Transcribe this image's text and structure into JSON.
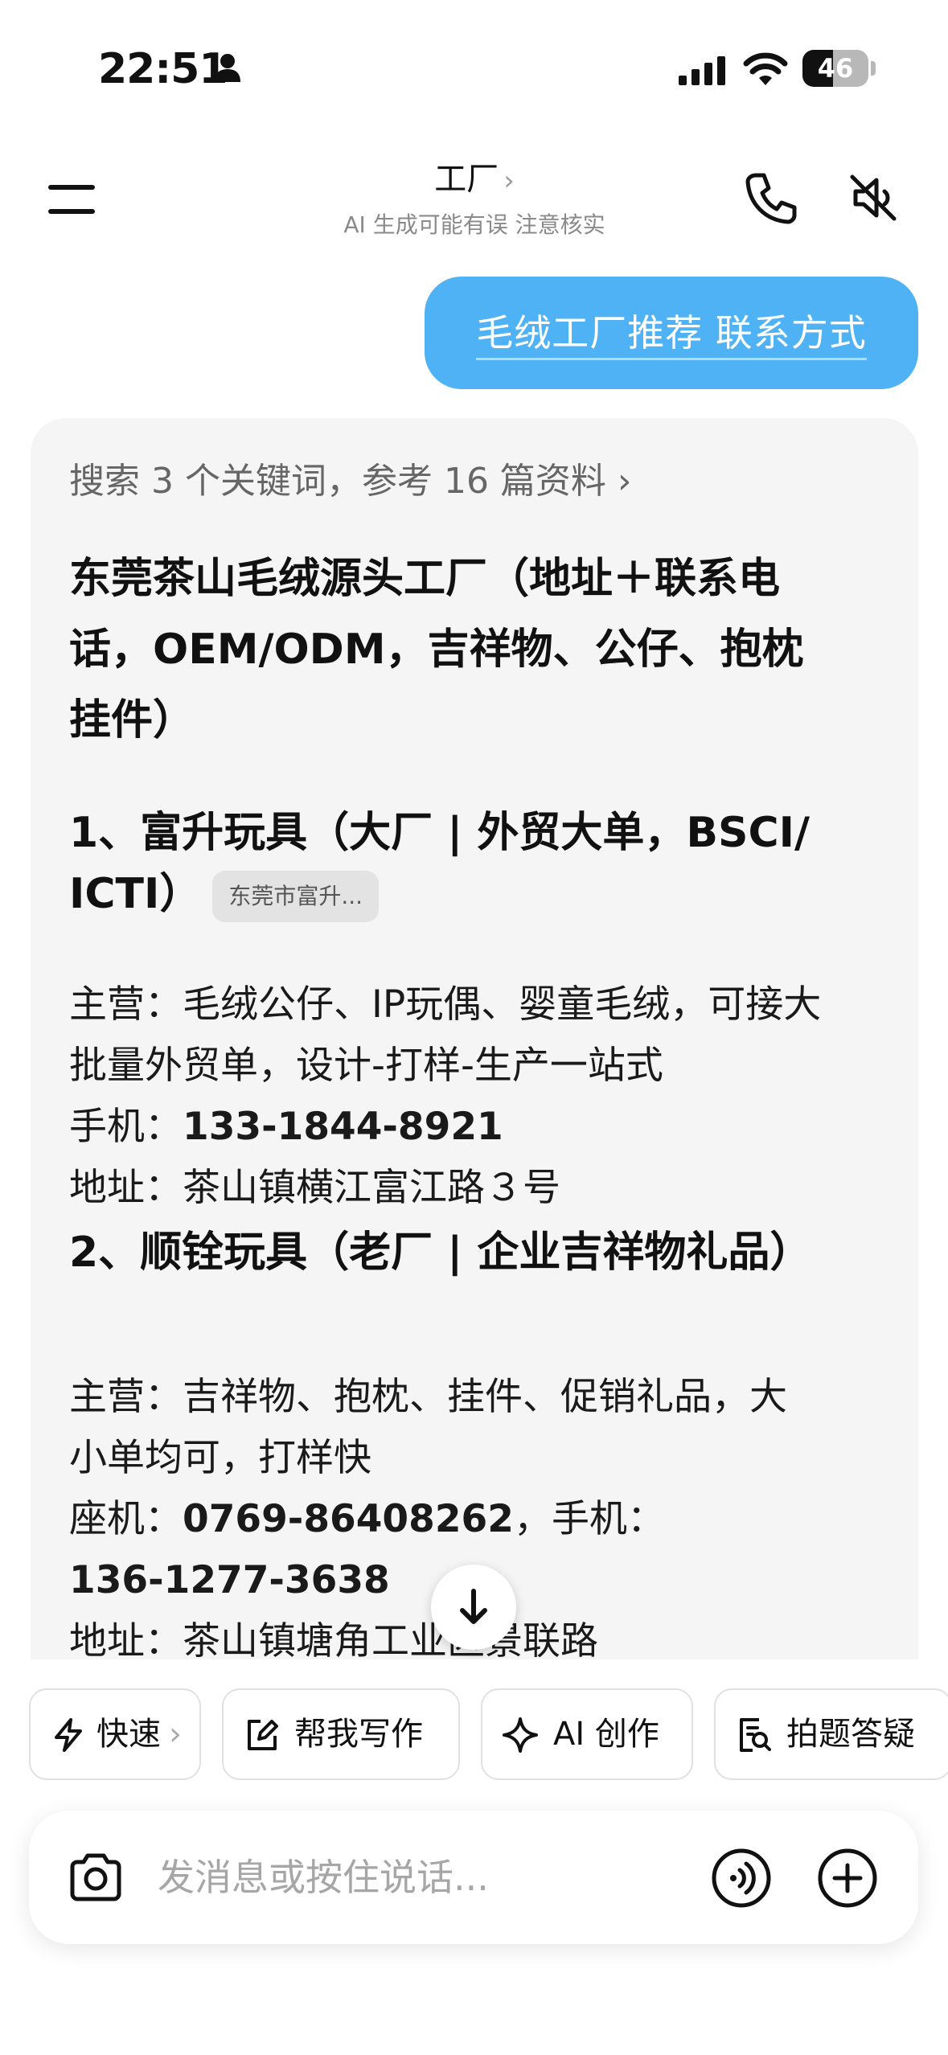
{
  "status_bar": {
    "time": "22:51",
    "battery_level": "46",
    "icons": [
      "person-icon",
      "signal-icon",
      "wifi-icon",
      "battery-icon"
    ]
  },
  "header": {
    "title": "工厂",
    "title_chevron": "›",
    "subtitle": "AI 生成可能有误 注意核实",
    "icons": [
      "menu-icon",
      "phone-icon",
      "speaker-mute-icon"
    ]
  },
  "user_message": "毛绒工厂推荐 联系方式",
  "answer": {
    "search_summary": "搜索 3 个关键词，参考 16 篇资料 ›",
    "headline_lines": [
      "东莞茶山毛绒源头工厂（地址＋联系电",
      "话，OEM/ODM，吉祥物、公仔、抱枕",
      "挂件）"
    ],
    "sections": [
      {
        "title_line1": "1、富升玩具（大厂 | 外贸大单，BSCI/",
        "title_line2": "ICTI）",
        "source_chip": "东莞市富升...",
        "main_business_line1": "主营：毛绒公仔、IP玩偶、婴童毛绒，可接大",
        "main_business_line2": "批量外贸单，设计-打样-生产一站式",
        "phone_label": "手机：",
        "phone": "133-1844-8921",
        "address": "地址：茶山镇横江富江路３号"
      },
      {
        "title": "2、顺铨玩具（老厂 | 企业吉祥物礼品）",
        "main_business_line1": "主营：吉祥物、抱枕、挂件、促销礼品，大",
        "main_business_line2": "小单均可，打样快",
        "landline_label": "座机：",
        "landline": "0769-86408262",
        "mobile_label": "，手机：",
        "mobile": "136-1277-3638",
        "address": "地址：茶山镇塘角工业区景联路"
      }
    ]
  },
  "quick_actions": [
    {
      "label": "快速",
      "icon": "lightning-icon",
      "suffix": "›"
    },
    {
      "label": "帮我写作",
      "icon": "edit-icon"
    },
    {
      "label": "AI 创作",
      "icon": "sparkle-icon"
    },
    {
      "label": "拍题答疑",
      "icon": "photo-search-icon"
    }
  ],
  "input": {
    "placeholder": "发消息或按住说话..."
  },
  "colors": {
    "user_bubble": "#4fb2f4",
    "card_background": "#f5f5f5"
  }
}
